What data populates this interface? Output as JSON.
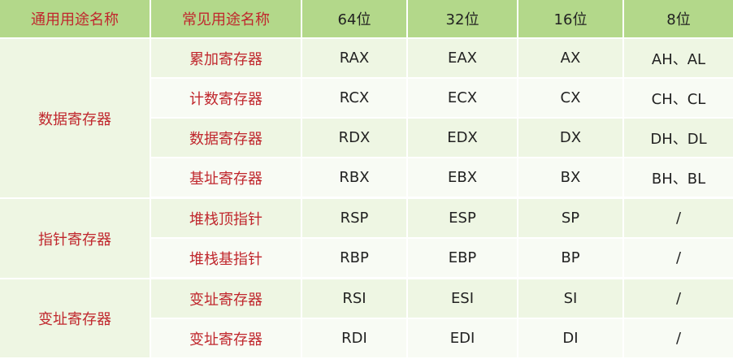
{
  "header": [
    "通用用途名称",
    "常见用途名称",
    "64位",
    "32位",
    "16位",
    "8位"
  ],
  "groups": [
    {
      "name": "数据寄存器",
      "rows": [
        {
          "purpose": "累加寄存器",
          "r64": "RAX",
          "r32": "EAX",
          "r16": "AX",
          "r8": "AH、AL"
        },
        {
          "purpose": "计数寄存器",
          "r64": "RCX",
          "r32": "ECX",
          "r16": "CX",
          "r8": "CH、CL"
        },
        {
          "purpose": "数据寄存器",
          "r64": "RDX",
          "r32": "EDX",
          "r16": "DX",
          "r8": "DH、DL"
        },
        {
          "purpose": "基址寄存器",
          "r64": "RBX",
          "r32": "EBX",
          "r16": "BX",
          "r8": "BH、BL"
        }
      ]
    },
    {
      "name": "指针寄存器",
      "rows": [
        {
          "purpose": "堆栈顶指针",
          "r64": "RSP",
          "r32": "ESP",
          "r16": "SP",
          "r8": "/"
        },
        {
          "purpose": "堆栈基指针",
          "r64": "RBP",
          "r32": "EBP",
          "r16": "BP",
          "r8": "/"
        }
      ]
    },
    {
      "name": "变址寄存器",
      "rows": [
        {
          "purpose": "变址寄存器",
          "r64": "RSI",
          "r32": "ESI",
          "r16": "SI",
          "r8": "/"
        },
        {
          "purpose": "变址寄存器",
          "r64": "RDI",
          "r32": "EDI",
          "r16": "DI",
          "r8": "/"
        }
      ]
    }
  ],
  "colors": {
    "header_bg": "#b3d88a",
    "accent_text": "#c0272d",
    "row_bg_a": "#eef6e3",
    "row_bg_b": "#f8fbf4"
  }
}
